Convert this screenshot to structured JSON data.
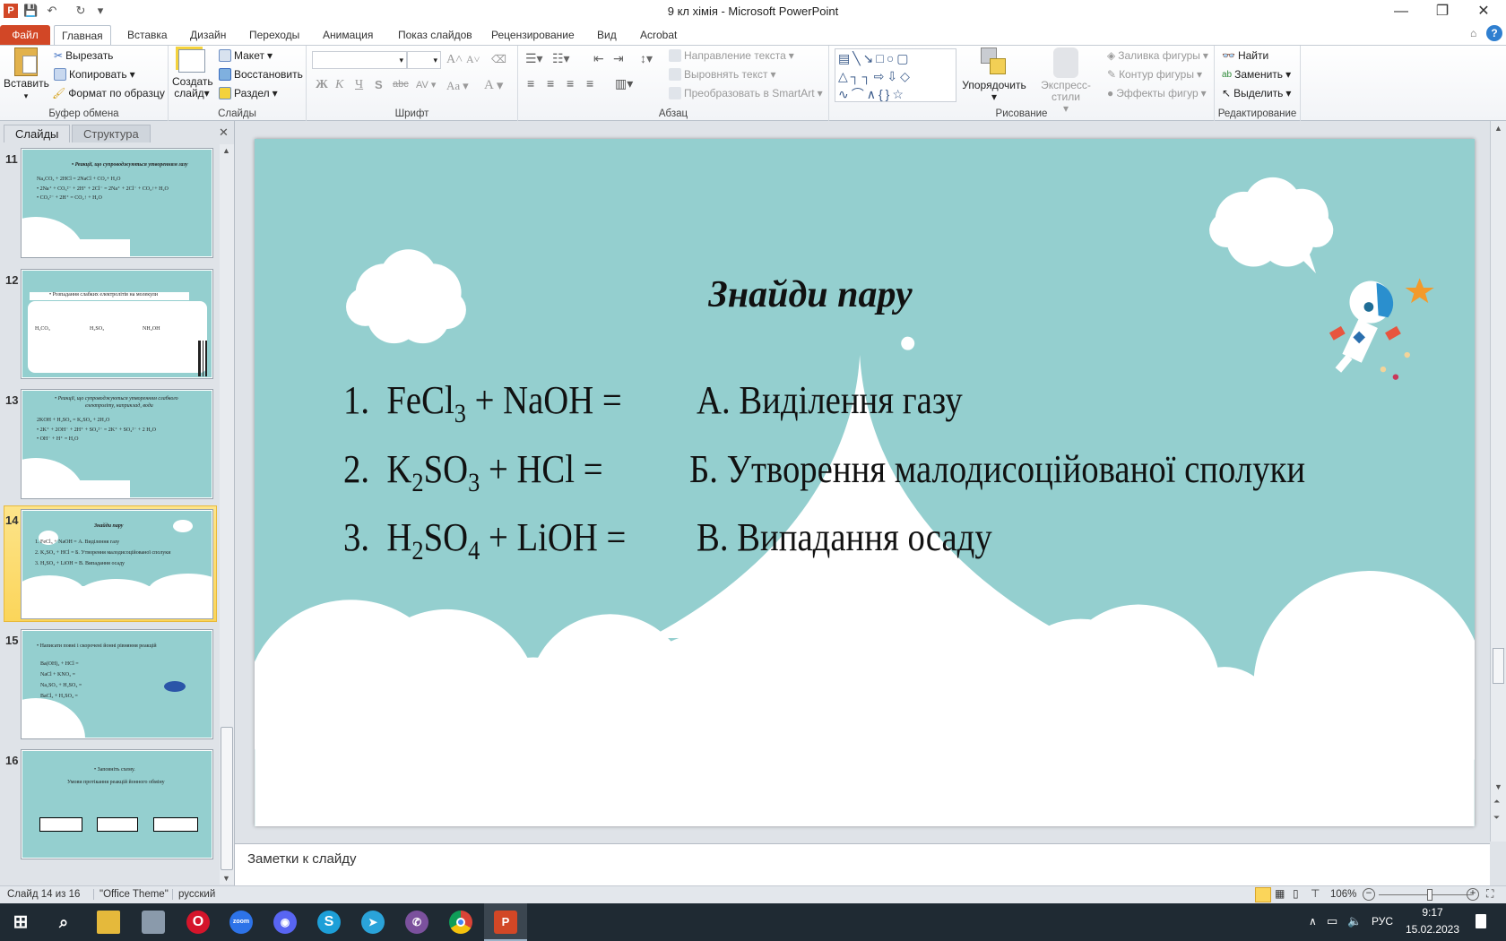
{
  "window": {
    "title": "9 кл хімія  -  Microsoft PowerPoint",
    "minimize": "—",
    "restore": "❐",
    "close": "✕"
  },
  "quick_access": {
    "save": "💾",
    "undo": "↶",
    "redo": "↻",
    "customize": "▾"
  },
  "ribbon_tabs": [
    "Файл",
    "Главная",
    "Вставка",
    "Дизайн",
    "Переходы",
    "Анимация",
    "Показ слайдов",
    "Рецензирование",
    "Вид",
    "Acrobat"
  ],
  "ribbon": {
    "clipboard": {
      "label": "Буфер обмена",
      "paste": "Вставить",
      "cut": "Вырезать",
      "copy": "Копировать",
      "format_painter": "Формат по образцу"
    },
    "slides": {
      "label": "Слайды",
      "new_slide_1": "Создать",
      "new_slide_2": "слайд",
      "layout": "Макет",
      "reset": "Восстановить",
      "section": "Раздел"
    },
    "font": {
      "label": "Шрифт",
      "font_name": "",
      "font_size": "",
      "grow": "A˄",
      "shrink": "A˅",
      "bold": "Ж",
      "italic": "К",
      "underline": "Ч",
      "shadow": "S",
      "strike": "abc",
      "spacing": "AV",
      "case": "Aa",
      "color": "A"
    },
    "paragraph": {
      "label": "Абзац",
      "text_direction": "Направление текста",
      "align_text": "Выровнять текст",
      "smartart": "Преобразовать в SmartArt"
    },
    "drawing": {
      "label": "Рисование",
      "arrange": "Упорядочить",
      "quick_styles": "Экспресс-стили",
      "fill": "Заливка фигуры",
      "outline": "Контур фигуры",
      "effects": "Эффекты фигур"
    },
    "editing": {
      "label": "Редактирование",
      "find": "Найти",
      "replace": "Заменить",
      "select": "Выделить"
    }
  },
  "panel": {
    "tab_slides": "Слайды",
    "tab_outline": "Структура",
    "close": "✕"
  },
  "thumbnails": [
    {
      "num": "11",
      "lines": [
        "• Реакції, що супроводжуються утворенням газу",
        "Na₂CO₃ + 2HCl = 2NaCl + CO₂+ H₂O",
        "• 2Na⁺ + CO₃²⁻ + 2H⁺ + 2Cl⁻ = 2Na⁺ + 2Cl⁻ + CO₂↑+ H₂O",
        "• CO₃²⁻ + 2H⁺ = CO₂↑ + H₂O"
      ]
    },
    {
      "num": "12",
      "lines": [
        "• Розпадання слабких електролітів на молекули",
        "H₂CO₃",
        "H₂SO₃",
        "NH₄OH"
      ]
    },
    {
      "num": "13",
      "lines": [
        "• Реакції, що супроводжуються утворенням слабкого",
        "електроліту, наприклад, води",
        "2KOH + H₂SO₄ = K₂SO₄ + 2H₂O",
        "• 2K⁺ + 2OH⁻ + 2H⁺ + SO₄²⁻ = 2K⁺ + SO₄²⁻ + 2 H₂O",
        "•  OH⁻ + H⁺ = H₂O"
      ]
    },
    {
      "num": "14",
      "lines": [
        "Знайди пару",
        "1.  FeCl₃ + NaOH =     А. Виділення газу",
        "2.  K₂SO₃ + HCl =      Б. Утворення малодисоційованої сполуки",
        "3.  H₂SO₄ + LiOH =     В. Випадання осаду"
      ]
    },
    {
      "num": "15",
      "lines": [
        "• Написати повні і скорочені йонні рівняння реакцій",
        "Ba(OH)₂ + HCl =",
        "NaCl + KNO₃ =",
        "Na₂SO₃ + H₂SO₄ =",
        "BaCl₂ + H₂SO₄ ="
      ]
    },
    {
      "num": "16",
      "lines": [
        "• Заповніть схему.",
        "Умови протікання реакцій йонного обміну"
      ]
    }
  ],
  "slide": {
    "title": "Знайди пару",
    "rows": [
      {
        "num": "1.",
        "formula": [
          {
            "t": "FeCl"
          },
          {
            "t": "3",
            "sub": true
          },
          {
            "t": " + NaOH ="
          }
        ],
        "answer": "А. Виділення газу"
      },
      {
        "num": "2.",
        "formula": [
          {
            "t": "K"
          },
          {
            "t": "2",
            "sub": true
          },
          {
            "t": "SO"
          },
          {
            "t": "3",
            "sub": true
          },
          {
            "t": " + HCl ="
          }
        ],
        "answer": "Б. Утворення малодисоційованої сполуки"
      },
      {
        "num": "3.",
        "formula": [
          {
            "t": "H"
          },
          {
            "t": "2",
            "sub": true
          },
          {
            "t": "SO"
          },
          {
            "t": "4",
            "sub": true
          },
          {
            "t": " + LiOH ="
          }
        ],
        "answer": "В. Випадання осаду"
      }
    ],
    "colors": {
      "background": "#94cfcf",
      "cloud": "#ffffff",
      "star": "#f39a2b",
      "helmet": "#2a8fce",
      "accent": "#e8553f"
    }
  },
  "notes": {
    "placeholder": "Заметки к слайду"
  },
  "status": {
    "slide_info": "Слайд 14 из 16",
    "theme": "\"Office Theme\"",
    "language": "русский",
    "zoom": "106%",
    "zoom_level": 0.55
  },
  "taskbar": {
    "apps": [
      "Пуск",
      "Поиск",
      "Проводник",
      "Принтер",
      "Opera",
      "Zoom",
      "Discord",
      "Skype",
      "Telegram",
      "Viber",
      "Chrome",
      "PowerPoint"
    ],
    "zoom_text": "zoom",
    "lang": "РУС",
    "time": "9:17",
    "date": "15.02.2023"
  }
}
